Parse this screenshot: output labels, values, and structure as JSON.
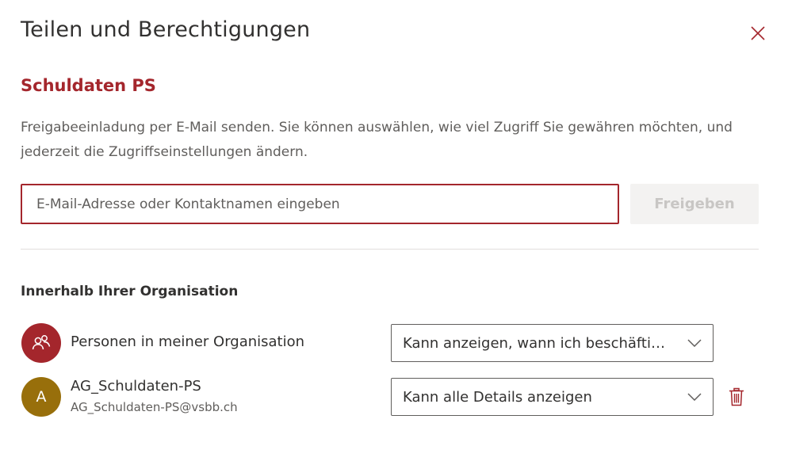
{
  "dialog": {
    "title": "Teilen und Berechtigungen",
    "item_name": "Schuldaten PS",
    "description": "Freigabeeinladung per E-Mail senden. Sie können auswählen, wie viel Zugriff Sie gewähren möchten, und jederzeit die Zugriffseinstellungen ändern.",
    "email_input": {
      "placeholder": "E-Mail-Adresse oder Kontaktnamen eingeben",
      "value": ""
    },
    "share_button_label": "Freigeben",
    "section_heading": "Innerhalb Ihrer Organisation",
    "entries": [
      {
        "name": "Personen in meiner Organisation",
        "avatar_icon": "people-icon",
        "permission": "Kann anzeigen, wann ich beschäftigt bin"
      },
      {
        "name": "AG_Schuldaten-PS",
        "email": "AG_Schuldaten-PS@vsbb.ch",
        "avatar_initial": "A",
        "permission": "Kann alle Details anzeigen"
      }
    ]
  },
  "colors": {
    "accent": "#a4262c",
    "group_avatar": "#986f0b",
    "text": "#323130",
    "secondary_text": "#605e5c",
    "disabled_button_bg": "#f3f2f1",
    "disabled_button_text": "#c8c6c4"
  }
}
